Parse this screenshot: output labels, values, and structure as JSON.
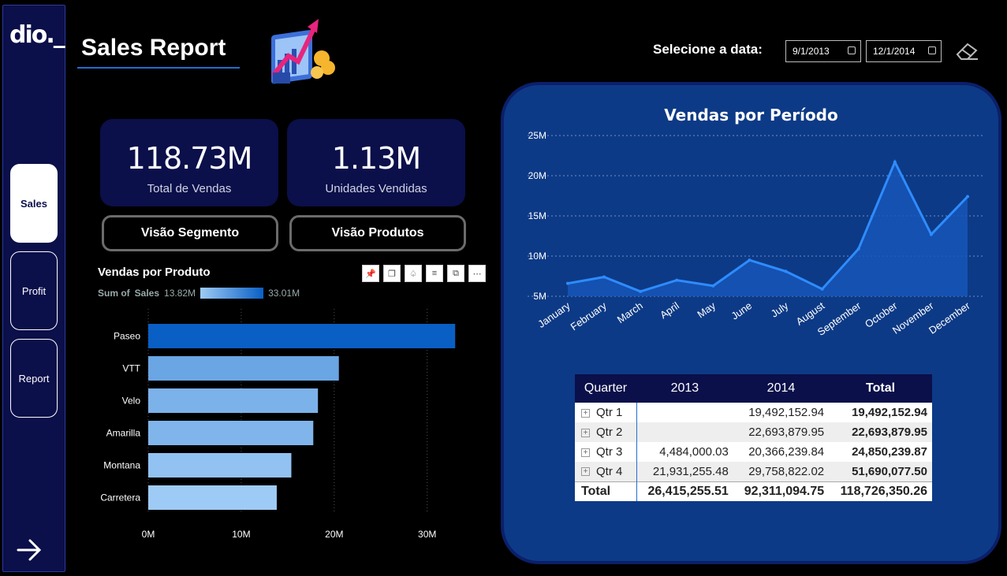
{
  "sidebar": {
    "logo": "dio._",
    "items": [
      {
        "label": "Sales",
        "active": true
      },
      {
        "label": "Profit",
        "active": false
      },
      {
        "label": "Report",
        "active": false
      }
    ],
    "next_icon": "arrow-right-icon"
  },
  "header": {
    "title": "Sales Report",
    "illustration": "growth-chart-illustration",
    "date_label": "Selecione a data:",
    "start_date": "9/1/2013",
    "end_date": "12/1/2014",
    "clear_icon": "eraser-icon"
  },
  "kpis": [
    {
      "value": "118.73M",
      "label": "Total de Vendas"
    },
    {
      "value": "1.13M",
      "label": "Unidades Vendidas"
    }
  ],
  "buttons": {
    "segment": "Visão Segmento",
    "products": "Visão Produtos"
  },
  "bar_visual": {
    "legend_prefix": "Sum of",
    "legend_field": "Sales",
    "legend_min": "13.82M",
    "legend_max": "33.01M",
    "toolbar": [
      "pin-icon",
      "copy-icon",
      "bell-icon",
      "filter-icon",
      "focus-icon",
      "more-icon"
    ]
  },
  "colors": {
    "accent": "#1f6fd1",
    "panel": "#0d3a86",
    "card": "#0b0f4a",
    "line": "#2e8cff"
  },
  "chart_data": [
    {
      "type": "bar",
      "title": "Vendas por Produto",
      "categories": [
        "Paseo",
        "VTT",
        "Velo",
        "Amarilla",
        "Montana",
        "Carretera"
      ],
      "values": [
        33.01,
        20.5,
        18.25,
        17.75,
        15.39,
        13.82
      ],
      "unit": "M",
      "xticks": [
        "0M",
        "10M",
        "20M",
        "30M"
      ],
      "xlim": [
        0,
        33.5
      ]
    },
    {
      "type": "area",
      "title": "Vendas por Período",
      "categories": [
        "January",
        "February",
        "March",
        "April",
        "May",
        "June",
        "July",
        "August",
        "September",
        "October",
        "November",
        "December"
      ],
      "values": [
        6.6,
        7.4,
        5.6,
        7.0,
        6.3,
        9.5,
        8.1,
        5.9,
        10.9,
        21.7,
        12.7,
        17.4
      ],
      "unit": "M",
      "yticks": [
        "5M",
        "10M",
        "15M",
        "20M",
        "25M"
      ],
      "ylim": [
        5,
        25
      ]
    }
  ],
  "table": {
    "headers": [
      "Quarter",
      "2013",
      "2014",
      "Total"
    ],
    "rows": [
      {
        "q": "Qtr 1",
        "y2013": "",
        "y2014": "19,492,152.94",
        "total": "19,492,152.94"
      },
      {
        "q": "Qtr 2",
        "y2013": "",
        "y2014": "22,693,879.95",
        "total": "22,693,879.95"
      },
      {
        "q": "Qtr 3",
        "y2013": "4,484,000.03",
        "y2014": "20,366,239.84",
        "total": "24,850,239.87"
      },
      {
        "q": "Qtr 4",
        "y2013": "21,931,255.48",
        "y2014": "29,758,822.02",
        "total": "51,690,077.50"
      }
    ],
    "total_row": {
      "q": "Total",
      "y2013": "26,415,255.51",
      "y2014": "92,311,094.75",
      "total": "118,726,350.26"
    }
  }
}
